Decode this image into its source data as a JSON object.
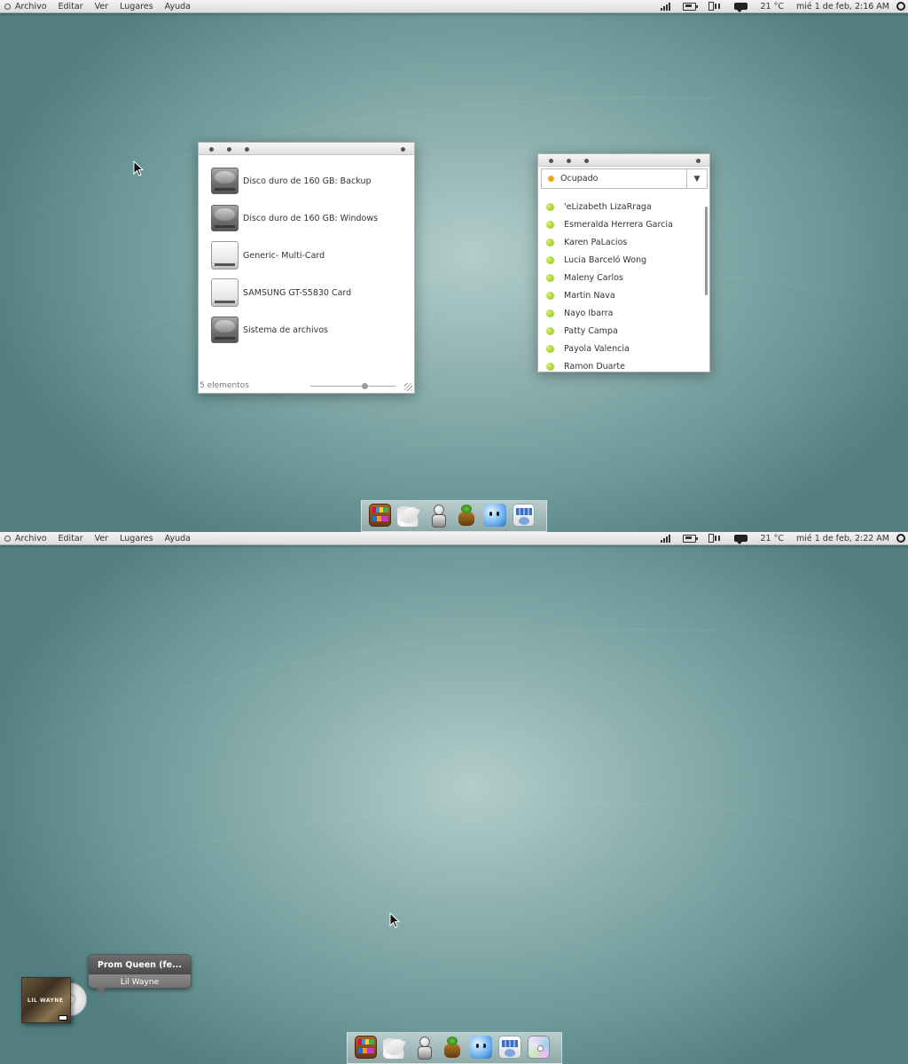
{
  "top": {
    "panel": {
      "menu": [
        "Archivo",
        "Editar",
        "Ver",
        "Lugares",
        "Ayuda"
      ],
      "temperature": "21 °C",
      "clock": "mié 1 de feb, 2:16 AM"
    },
    "drives_window": {
      "items": [
        {
          "name": "Disco duro de 160 GB: Backup",
          "icon": "hard-drive-icon"
        },
        {
          "name": "Disco duro de 160 GB: Windows",
          "icon": "hard-drive-icon"
        },
        {
          "name": "Generic- Multi-Card",
          "icon": "card-reader-icon"
        },
        {
          "name": "SAMSUNG GT-S5830 Card",
          "icon": "card-reader-icon"
        },
        {
          "name": "Sistema de archivos",
          "icon": "hard-drive-icon"
        }
      ],
      "status": "5 elementos"
    },
    "contacts_window": {
      "status_label": "Ocupado",
      "status_color": "#f0a818",
      "online_color": "#8cbc10",
      "contacts": [
        "'eLizabeth LizaRraga",
        "Esmeralda Herrera Garcia",
        "Karen PaLacios",
        "Lucia Barceló Wong",
        "Maleny Carlos",
        "Martin Nava",
        "Nayo Ibarra",
        "Patty Campa",
        "Payola Valencia",
        "Ramon Duarte"
      ]
    },
    "dock_icons": [
      "bookshelf-icon",
      "wing-icon",
      "robot-icon",
      "plant-pot-icon",
      "blue-face-icon",
      "disks-icon"
    ]
  },
  "bottom": {
    "panel": {
      "menu": [
        "Archivo",
        "Editar",
        "Ver",
        "Lugares",
        "Ayuda"
      ],
      "temperature": "21 °C",
      "clock": "mié 1 de feb, 2:22 AM"
    },
    "now_playing": {
      "title": "Prom Queen (fe...",
      "artist": "Lil Wayne",
      "cover_text": "LIL WAYNE"
    },
    "dock_icons": [
      "bookshelf-icon",
      "wing-icon",
      "robot-icon",
      "plant-pot-icon",
      "blue-face-icon",
      "disks-icon",
      "cd-icon"
    ]
  }
}
